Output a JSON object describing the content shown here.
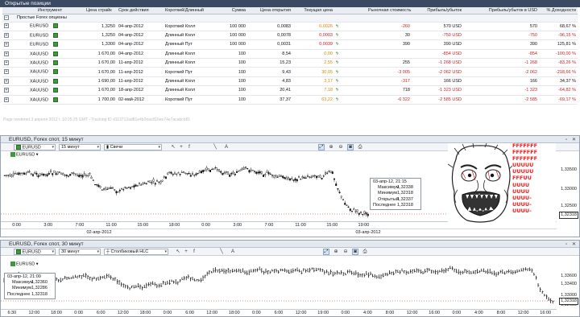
{
  "positions": {
    "title": "Открытые позиции",
    "columns": [
      "",
      "Инструмент",
      "Цена страйк",
      "Срок действия",
      "Короткий/Длинный",
      "Сумма",
      "Цена открытия",
      "Текущая цена",
      "",
      "Рыночная стоимость",
      "Прибыль/убыток",
      "Прибыль/убыток в USD",
      "% Доходности"
    ],
    "group_label": "Простые Forex опционы",
    "rows": [
      {
        "sym": "EURUSD",
        "strike": "1,3250",
        "exp": "04-апр-2012",
        "side": "Короткий Колл",
        "amount": "100 000",
        "open": "0,0083",
        "cur": "0,0026",
        "mv": "-260",
        "pl": "570 USD",
        "plusd": "570",
        "pct": "68,67 %"
      },
      {
        "sym": "EURUSD",
        "strike": "1,3250",
        "exp": "04-апр-2012",
        "side": "Длинный Колл",
        "amount": "100 000",
        "open": "0,0078",
        "cur": "0,0003",
        "mv": "30",
        "pl": "-750 USD",
        "plusd": "-750",
        "pct": "-96,15 %"
      },
      {
        "sym": "EURUSD",
        "strike": "1,3300",
        "exp": "04-апр-2012",
        "side": "Длинный Пут",
        "amount": "100 000",
        "open": "0,0031",
        "cur": "0,0039",
        "mv": "390",
        "pl": "390 USD",
        "plusd": "390",
        "pct": "125,81 %"
      },
      {
        "sym": "XAUUSD",
        "strike": "1 670,00",
        "exp": "04-апр-2012",
        "side": "Длинный Колл",
        "amount": "100",
        "open": "8,54",
        "cur": "0,00",
        "mv": "",
        "pl": "-854 USD",
        "plusd": "-854",
        "pct": "-100,00 %"
      },
      {
        "sym": "XAUUSD",
        "strike": "1 670,00",
        "exp": "11-апр-2012",
        "side": "Длинный Колл",
        "amount": "100",
        "open": "15,23",
        "cur": "2,55",
        "mv": "255",
        "pl": "-1 268 USD",
        "plusd": "-1 268",
        "pct": "-83,26 %"
      },
      {
        "sym": "XAUUSD",
        "strike": "1 670,00",
        "exp": "11-апр-2012",
        "side": "Короткий Пут",
        "amount": "100",
        "open": "9,43",
        "cur": "30,05",
        "mv": "-3 005",
        "pl": "-2 062 USD",
        "plusd": "-2 062",
        "pct": "-218,66 %"
      },
      {
        "sym": "XAUUSD",
        "strike": "1 690,00",
        "exp": "11-апр-2012",
        "side": "Длинный Колл",
        "amount": "100",
        "open": "4,83",
        "cur": "3,17",
        "mv": "-317",
        "pl": "166 USD",
        "plusd": "166",
        "pct": "34,37 %"
      },
      {
        "sym": "XAUUSD",
        "strike": "1 670,00",
        "exp": "18-апр-2012",
        "side": "Длинный Колл",
        "amount": "100",
        "open": "20,41",
        "cur": "7,18",
        "mv": "718",
        "pl": "-1 323 USD",
        "plusd": "-1 323",
        "pct": "-64,82 %"
      },
      {
        "sym": "XAUUSD",
        "strike": "1 700,00",
        "exp": "02-май-2012",
        "side": "Короткий Пут",
        "amount": "100",
        "open": "37,37",
        "cur": "63,22",
        "mv": "-6 322",
        "pl": "-2 585 USD",
        "plusd": "-2 585",
        "pct": "-69,17 %"
      }
    ],
    "note": "Page rendered 3 апреля 2012 г. 10:25:25 GMT - Tracking ID d113712ad81e4b2eac816ee74e7acabcb81"
  },
  "chart1": {
    "title": "EURUSD, Forex спот, 15 минут",
    "symbol": "EURUSD",
    "period": "15 минут",
    "chart_type": "Свечи",
    "tag_symbol": "EURUSD",
    "price_labels": [
      "1,33500",
      "1,33000",
      "1,32500"
    ],
    "last_price": "1,32318",
    "time_labels": [
      "0:00",
      "3:00",
      "7:00",
      "11:00",
      "15:00",
      "18:00",
      "0:00",
      "3:00",
      "7:00",
      "11:00",
      "15:00",
      "19:00"
    ],
    "date_labels": [
      "02-апр-2012",
      "03-апр-2012"
    ],
    "info": {
      "time": "03-апр-12, 21:15",
      "max_label": "Максимум",
      "max": "1,32338",
      "min_label": "Минимум",
      "min": "1,32318",
      "open_label": "Открытый",
      "open": "1,32337",
      "last_label": "Последнее",
      "last": "1,32318"
    }
  },
  "chart2": {
    "title": "EURUSD, Forex спот, 30 минут",
    "symbol": "EURUSD",
    "period": "30 минут",
    "chart_type": "Столбиковый HLC",
    "tag_symbol": "EURUSD",
    "price_labels": [
      "1,33600",
      "1,33400",
      "1,33000",
      "1,32600"
    ],
    "last_price": "1,32318",
    "time_labels": [
      "6:30",
      "12:00",
      "18:00",
      "0:00",
      "6:00",
      "12:00",
      "18:00",
      "0:00",
      "6:00",
      "12:00",
      "18:00",
      "0:00",
      "6:00",
      "12:00",
      "19:00",
      "0:00",
      "4:00",
      "8:00",
      "12:00",
      "16:00",
      "0:00",
      "4:00",
      "8:00",
      "12:00",
      "16:00"
    ],
    "info": {
      "time": "03-апр-12, 21:00",
      "max_label": "Максимум",
      "max": "1,32360",
      "min_label": "Минимум",
      "min": "1,32286",
      "last_label": "Последнее",
      "last": "1,32318"
    }
  },
  "meme_text": [
    "FFFFFFF",
    "FFFFFFF",
    "FFFFFFF",
    "UUUUU",
    "UUUUU",
    "FFFUU",
    "UUUU",
    "UUUU",
    "UUUU-",
    "UUUU-",
    "UUUU-"
  ],
  "colors": {
    "positive_orange": "#d98a00",
    "negative": "#d01c1c",
    "title_bar": "#3a4a63",
    "bolt": "#2b8f2b"
  }
}
